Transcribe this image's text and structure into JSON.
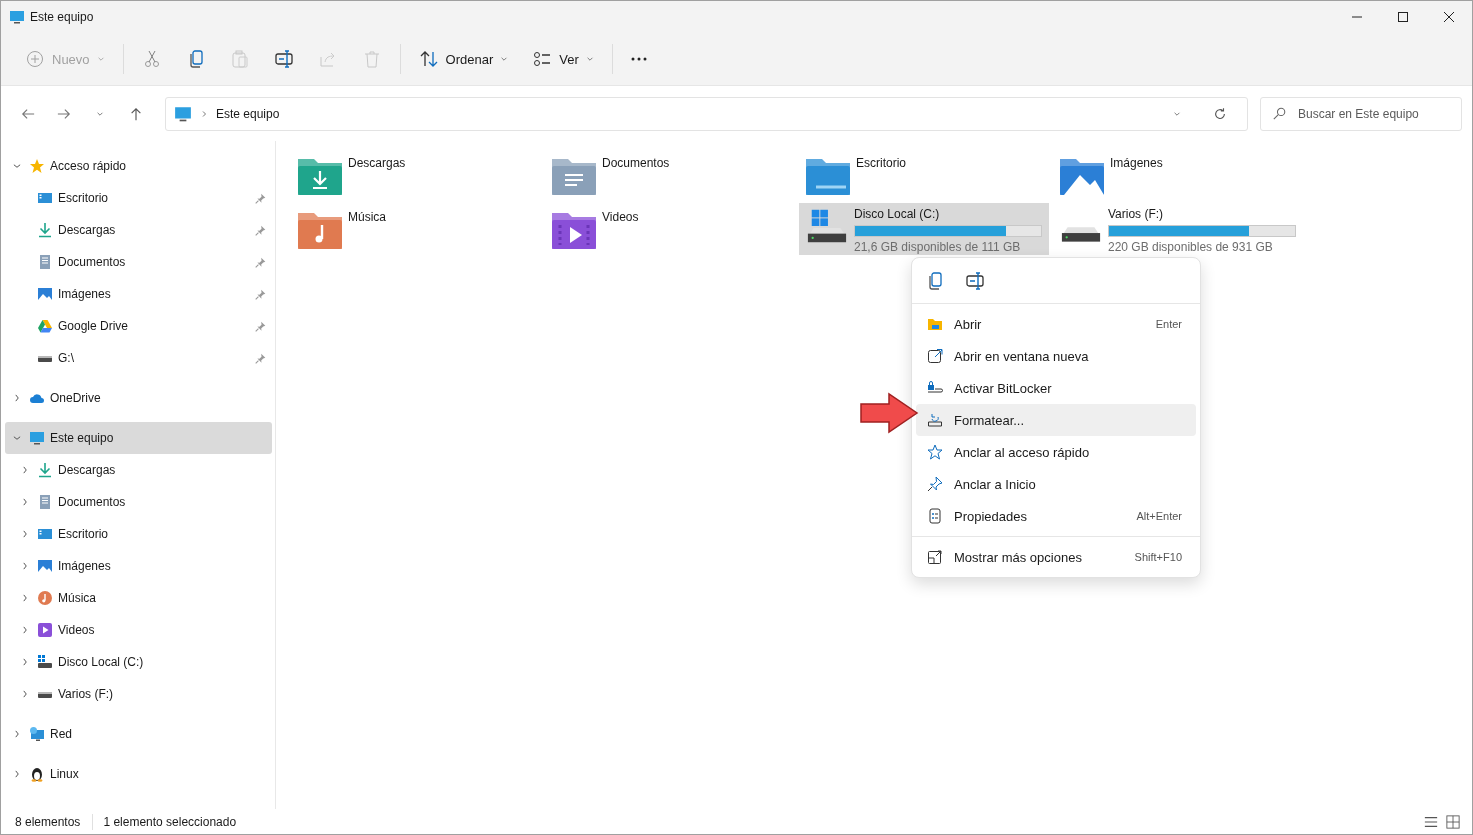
{
  "window": {
    "title": "Este equipo"
  },
  "toolbar": {
    "items": [
      {
        "kind": "new",
        "label": "Nuevo",
        "disabled": true
      },
      {
        "kind": "cut",
        "disabled": true
      },
      {
        "kind": "copy",
        "disabled": false
      },
      {
        "kind": "paste",
        "disabled": true
      },
      {
        "kind": "rename",
        "disabled": false
      },
      {
        "kind": "share",
        "disabled": true
      },
      {
        "kind": "delete",
        "disabled": true
      },
      {
        "kind": "sort",
        "label": "Ordenar",
        "disabled": false
      },
      {
        "kind": "view",
        "label": "Ver",
        "disabled": false
      },
      {
        "kind": "more"
      }
    ]
  },
  "address": {
    "path": "Este equipo"
  },
  "search": {
    "placeholder": "Buscar en Este equipo"
  },
  "sidebar": {
    "items": [
      {
        "label": "Acceso rápido",
        "kind": "star",
        "expanded": true,
        "selected": false,
        "children": [
          {
            "label": "Escritorio",
            "kind": "desktop",
            "pinned": true,
            "selected": false
          },
          {
            "label": "Descargas",
            "kind": "download",
            "pinned": true,
            "selected": false
          },
          {
            "label": "Documentos",
            "kind": "documents",
            "pinned": true,
            "selected": false
          },
          {
            "label": "Imágenes",
            "kind": "pictures",
            "pinned": true,
            "selected": false
          },
          {
            "label": "Google Drive",
            "kind": "triangle",
            "pinned": true,
            "selected": false
          },
          {
            "label": "G:\\",
            "kind": "drive",
            "pinned": true,
            "selected": false
          }
        ]
      },
      {
        "label": "OneDrive",
        "kind": "cloud",
        "expanded": false,
        "selected": false
      },
      {
        "label": "Este equipo",
        "kind": "pc",
        "expanded": true,
        "selected": true,
        "children": [
          {
            "label": "Descargas",
            "kind": "download",
            "expanded": false,
            "selected": false
          },
          {
            "label": "Documentos",
            "kind": "documents",
            "expanded": false,
            "selected": false
          },
          {
            "label": "Escritorio",
            "kind": "desktop",
            "expanded": false,
            "selected": false
          },
          {
            "label": "Imágenes",
            "kind": "pictures",
            "expanded": false,
            "selected": false
          },
          {
            "label": "Música",
            "kind": "music",
            "expanded": false,
            "selected": false
          },
          {
            "label": "Videos",
            "kind": "videos",
            "expanded": false,
            "selected": false
          },
          {
            "label": "Disco Local (C:)",
            "kind": "windrive",
            "expanded": false,
            "selected": false
          },
          {
            "label": "Varios (F:)",
            "kind": "drive",
            "expanded": false,
            "selected": false
          }
        ]
      },
      {
        "label": "Red",
        "kind": "network",
        "expanded": false,
        "selected": false
      },
      {
        "label": "Linux",
        "kind": "linux",
        "expanded": false,
        "selected": false
      }
    ]
  },
  "content": {
    "items": [
      {
        "kind": "download",
        "name": "Descargas",
        "selected": false
      },
      {
        "kind": "documents",
        "name": "Documentos",
        "selected": false
      },
      {
        "kind": "desktop",
        "name": "Escritorio",
        "selected": false
      },
      {
        "kind": "pictures",
        "name": "Imágenes",
        "selected": false
      },
      {
        "kind": "music",
        "name": "Música",
        "selected": false
      },
      {
        "kind": "videos",
        "name": "Videos",
        "selected": false
      },
      {
        "kind": "windrive",
        "name": "Disco Local (C:)",
        "level": 0.81,
        "free": "21,6 GB disponibles de 111 GB",
        "selected": true
      },
      {
        "kind": "drive",
        "name": "Varios (F:)",
        "level": 0.75,
        "free": "220 GB disponibles de 931 GB",
        "selected": false
      }
    ]
  },
  "context_menu": {
    "quick_actions": [
      {
        "kind": "copy"
      },
      {
        "kind": "rename"
      }
    ],
    "items": [
      {
        "label": "Abrir",
        "shortcut": "Enter",
        "kind": "folder",
        "selected": false
      },
      {
        "label": "Abrir en ventana nueva",
        "kind": "newwindow",
        "selected": false
      },
      {
        "label": "Activar BitLocker",
        "kind": "lock",
        "selected": false
      },
      {
        "label": "Formatear...",
        "kind": "format",
        "selected": true
      },
      {
        "label": "Anclar al acceso rápido",
        "kind": "star",
        "selected": false
      },
      {
        "label": "Anclar a Inicio",
        "kind": "pin",
        "selected": false
      },
      {
        "label": "Propiedades",
        "shortcut": "Alt+Enter",
        "kind": "properties",
        "selected": false
      }
    ],
    "footer_items": [
      {
        "label": "Mostrar más opciones",
        "shortcut": "Shift+F10",
        "kind": "expand",
        "selected": false
      }
    ]
  },
  "status_bar": {
    "count": "8 elementos",
    "selection": "1 elemento seleccionado"
  }
}
